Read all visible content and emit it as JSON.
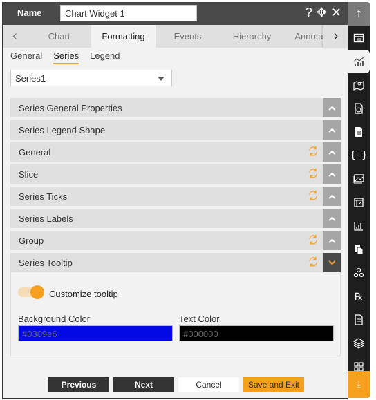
{
  "header": {
    "name_label": "Name",
    "name_value": "Chart Widget 1",
    "icons": [
      "help-icon",
      "move-icon",
      "close-icon"
    ]
  },
  "tabs": {
    "items": [
      {
        "label": "Chart",
        "active": false
      },
      {
        "label": "Formatting",
        "active": true
      },
      {
        "label": "Events",
        "active": false
      },
      {
        "label": "Hierarchy",
        "active": false
      },
      {
        "label": "Annotation",
        "active": false
      }
    ]
  },
  "subtabs": {
    "items": [
      {
        "label": "General",
        "active": false
      },
      {
        "label": "Series",
        "active": true
      },
      {
        "label": "Legend",
        "active": false
      }
    ]
  },
  "series_select": {
    "value": "Series1"
  },
  "accordion": {
    "sections": [
      {
        "label": "Series General Properties",
        "reset": false,
        "open": false
      },
      {
        "label": "Series Legend Shape",
        "reset": false,
        "open": false
      },
      {
        "label": "General",
        "reset": true,
        "open": false
      },
      {
        "label": "Slice",
        "reset": true,
        "open": false
      },
      {
        "label": "Series Ticks",
        "reset": true,
        "open": false
      },
      {
        "label": "Series Labels",
        "reset": false,
        "open": false
      },
      {
        "label": "Group",
        "reset": true,
        "open": false
      },
      {
        "label": "Series Tooltip",
        "reset": true,
        "open": true
      }
    ]
  },
  "tooltip": {
    "toggle_label": "Customize tooltip",
    "toggle_on": true,
    "bg_label": "Background Color",
    "bg_value": "#0309e6",
    "text_label": "Text Color",
    "text_value": "#000000"
  },
  "footer": {
    "previous": "Previous",
    "next": "Next",
    "cancel": "Cancel",
    "save": "Save and Exit"
  },
  "rail": {
    "items": [
      "collapse-top-icon",
      "widget-icon",
      "chart-icon",
      "map-icon",
      "report-icon",
      "document-icon",
      "code-icon",
      "image-icon",
      "table-icon",
      "analytics-icon",
      "pages-icon",
      "hierarchy-icon",
      "rx-icon",
      "form-icon",
      "layers-icon",
      "grid-icon",
      "download-icon"
    ],
    "active": "chart-icon"
  },
  "colors": {
    "accent": "#f7a01e",
    "header_bg": "#4a4a4a",
    "rail_bg": "#1e1e1e"
  }
}
